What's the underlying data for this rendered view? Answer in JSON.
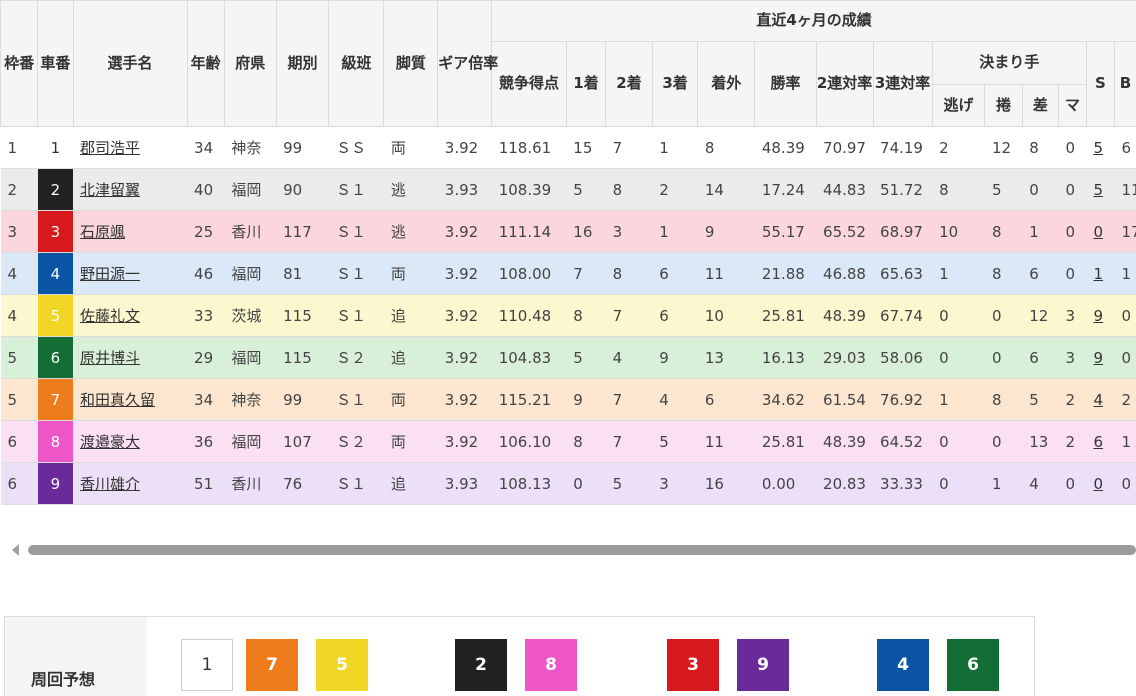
{
  "header": {
    "waku": "枠番",
    "sha": "車番",
    "name": "選手名",
    "age": "年齢",
    "pref": "府県",
    "term": "期別",
    "class": "級班",
    "style": "脚質",
    "gear": "ギア倍率",
    "recent": "直近4ヶ月の成績",
    "score": "競争得点",
    "first": "1着",
    "second": "2着",
    "third": "3着",
    "out": "着外",
    "win_rate": "勝率",
    "quinella": "2連対率",
    "trio": "3連対率",
    "kimarite": "決まり手",
    "nige": "逃げ",
    "makuri": "捲",
    "sashi": "差",
    "mark": "マ",
    "s": "S",
    "b": "B"
  },
  "colors": {
    "car": [
      "#ffffff",
      "#222222",
      "#d7191e",
      "#0c55a4",
      "#f2d625",
      "#146d35",
      "#ee7c1c",
      "#ee55c6",
      "#6a2a9a"
    ],
    "row": [
      "#ffffff",
      "#ebebeb",
      "#fbd7dd",
      "#dbe8f7",
      "#fdf7cf",
      "#d8f0d8",
      "#fde6cf",
      "#fbe0f4",
      "#ece0f8"
    ]
  },
  "racers": [
    {
      "waku": "1",
      "car": "1",
      "name": "郡司浩平",
      "age": "34",
      "pref": "神奈",
      "term": "99",
      "class": "ＳＳ",
      "style": "両",
      "gear": "3.92",
      "score": "118.61",
      "first": "15",
      "second": "7",
      "third": "1",
      "out": "8",
      "win": "48.39",
      "q2": "70.97",
      "q3": "74.19",
      "nige": "2",
      "makuri": "12",
      "sashi": "8",
      "mark": "0",
      "s": "5",
      "b": "6"
    },
    {
      "waku": "2",
      "car": "2",
      "name": "北津留翼",
      "age": "40",
      "pref": "福岡",
      "term": "90",
      "class": "Ｓ１",
      "style": "逃",
      "gear": "3.93",
      "score": "108.39",
      "first": "5",
      "second": "8",
      "third": "2",
      "out": "14",
      "win": "17.24",
      "q2": "44.83",
      "q3": "51.72",
      "nige": "8",
      "makuri": "5",
      "sashi": "0",
      "mark": "0",
      "s": "5",
      "b": "11"
    },
    {
      "waku": "3",
      "car": "3",
      "name": "石原颯",
      "age": "25",
      "pref": "香川",
      "term": "117",
      "class": "Ｓ１",
      "style": "逃",
      "gear": "3.92",
      "score": "111.14",
      "first": "16",
      "second": "3",
      "third": "1",
      "out": "9",
      "win": "55.17",
      "q2": "65.52",
      "q3": "68.97",
      "nige": "10",
      "makuri": "8",
      "sashi": "1",
      "mark": "0",
      "s": "0",
      "b": "17"
    },
    {
      "waku": "4",
      "car": "4",
      "name": "野田源一",
      "age": "46",
      "pref": "福岡",
      "term": "81",
      "class": "Ｓ１",
      "style": "両",
      "gear": "3.92",
      "score": "108.00",
      "first": "7",
      "second": "8",
      "third": "6",
      "out": "11",
      "win": "21.88",
      "q2": "46.88",
      "q3": "65.63",
      "nige": "1",
      "makuri": "8",
      "sashi": "6",
      "mark": "0",
      "s": "1",
      "b": "1"
    },
    {
      "waku": "4",
      "car": "5",
      "name": "佐藤礼文",
      "age": "33",
      "pref": "茨城",
      "term": "115",
      "class": "Ｓ１",
      "style": "追",
      "gear": "3.92",
      "score": "110.48",
      "first": "8",
      "second": "7",
      "third": "6",
      "out": "10",
      "win": "25.81",
      "q2": "48.39",
      "q3": "67.74",
      "nige": "0",
      "makuri": "0",
      "sashi": "12",
      "mark": "3",
      "s": "9",
      "b": "0"
    },
    {
      "waku": "5",
      "car": "6",
      "name": "原井博斗",
      "age": "29",
      "pref": "福岡",
      "term": "115",
      "class": "Ｓ２",
      "style": "追",
      "gear": "3.92",
      "score": "104.83",
      "first": "5",
      "second": "4",
      "third": "9",
      "out": "13",
      "win": "16.13",
      "q2": "29.03",
      "q3": "58.06",
      "nige": "0",
      "makuri": "0",
      "sashi": "6",
      "mark": "3",
      "s": "9",
      "b": "0"
    },
    {
      "waku": "5",
      "car": "7",
      "name": "和田真久留",
      "age": "34",
      "pref": "神奈",
      "term": "99",
      "class": "Ｓ１",
      "style": "両",
      "gear": "3.92",
      "score": "115.21",
      "first": "9",
      "second": "7",
      "third": "4",
      "out": "6",
      "win": "34.62",
      "q2": "61.54",
      "q3": "76.92",
      "nige": "1",
      "makuri": "8",
      "sashi": "5",
      "mark": "2",
      "s": "4",
      "b": "2"
    },
    {
      "waku": "6",
      "car": "8",
      "name": "渡邉豪大",
      "age": "36",
      "pref": "福岡",
      "term": "107",
      "class": "Ｓ２",
      "style": "両",
      "gear": "3.92",
      "score": "106.10",
      "first": "8",
      "second": "7",
      "third": "5",
      "out": "11",
      "win": "25.81",
      "q2": "48.39",
      "q3": "64.52",
      "nige": "0",
      "makuri": "0",
      "sashi": "13",
      "mark": "2",
      "s": "6",
      "b": "1"
    },
    {
      "waku": "6",
      "car": "9",
      "name": "香川雄介",
      "age": "51",
      "pref": "香川",
      "term": "76",
      "class": "Ｓ１",
      "style": "追",
      "gear": "3.93",
      "score": "108.13",
      "first": "0",
      "second": "5",
      "third": "3",
      "out": "16",
      "win": "0.00",
      "q2": "20.83",
      "q3": "33.33",
      "nige": "0",
      "makuri": "1",
      "sashi": "4",
      "mark": "0",
      "s": "0",
      "b": "0"
    }
  ],
  "prediction": {
    "label": "周回予想",
    "cars": [
      "1",
      "7",
      "5",
      "2",
      "8",
      "3",
      "9",
      "4",
      "6"
    ]
  }
}
